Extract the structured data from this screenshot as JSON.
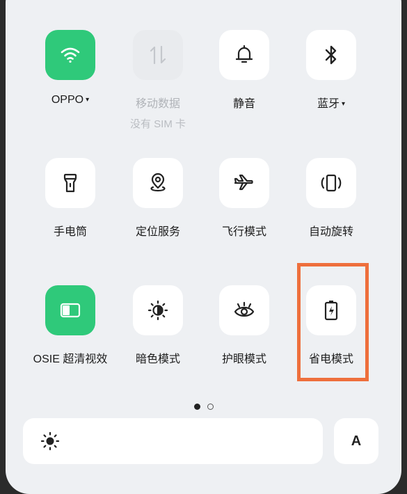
{
  "tiles": [
    {
      "label": "OPPO",
      "caret": "▾",
      "state": "on",
      "icon": "wifi-icon"
    },
    {
      "label": "移动数据",
      "sub": "没有 SIM 卡",
      "state": "disabled",
      "icon": "mobile-data-icon"
    },
    {
      "label": "静音",
      "state": "off",
      "icon": "bell-icon"
    },
    {
      "label": "蓝牙",
      "caret": "▾",
      "state": "off",
      "icon": "bluetooth-icon"
    },
    {
      "label": "手电筒",
      "state": "off",
      "icon": "flashlight-icon"
    },
    {
      "label": "定位服务",
      "state": "off",
      "icon": "location-icon"
    },
    {
      "label": "飞行模式",
      "state": "off",
      "icon": "airplane-icon"
    },
    {
      "label": "自动旋转",
      "state": "off",
      "icon": "auto-rotate-icon"
    },
    {
      "label": "OSIE 超清视效",
      "state": "on",
      "icon": "osie-icon"
    },
    {
      "label": "暗色模式",
      "state": "off",
      "icon": "dark-mode-icon"
    },
    {
      "label": "护眼模式",
      "state": "off",
      "icon": "eye-icon"
    },
    {
      "label": "省电模式",
      "state": "off",
      "icon": "battery-saver-icon",
      "highlighted": true
    }
  ],
  "pager": {
    "pages": 2,
    "current": 1
  },
  "brightness": {
    "icon": "sun-icon"
  },
  "auto_brightness": {
    "label": "A"
  },
  "colors": {
    "accent": "#2fc97a",
    "panel": "#eef0f3",
    "highlight": "#ee6f3c"
  }
}
